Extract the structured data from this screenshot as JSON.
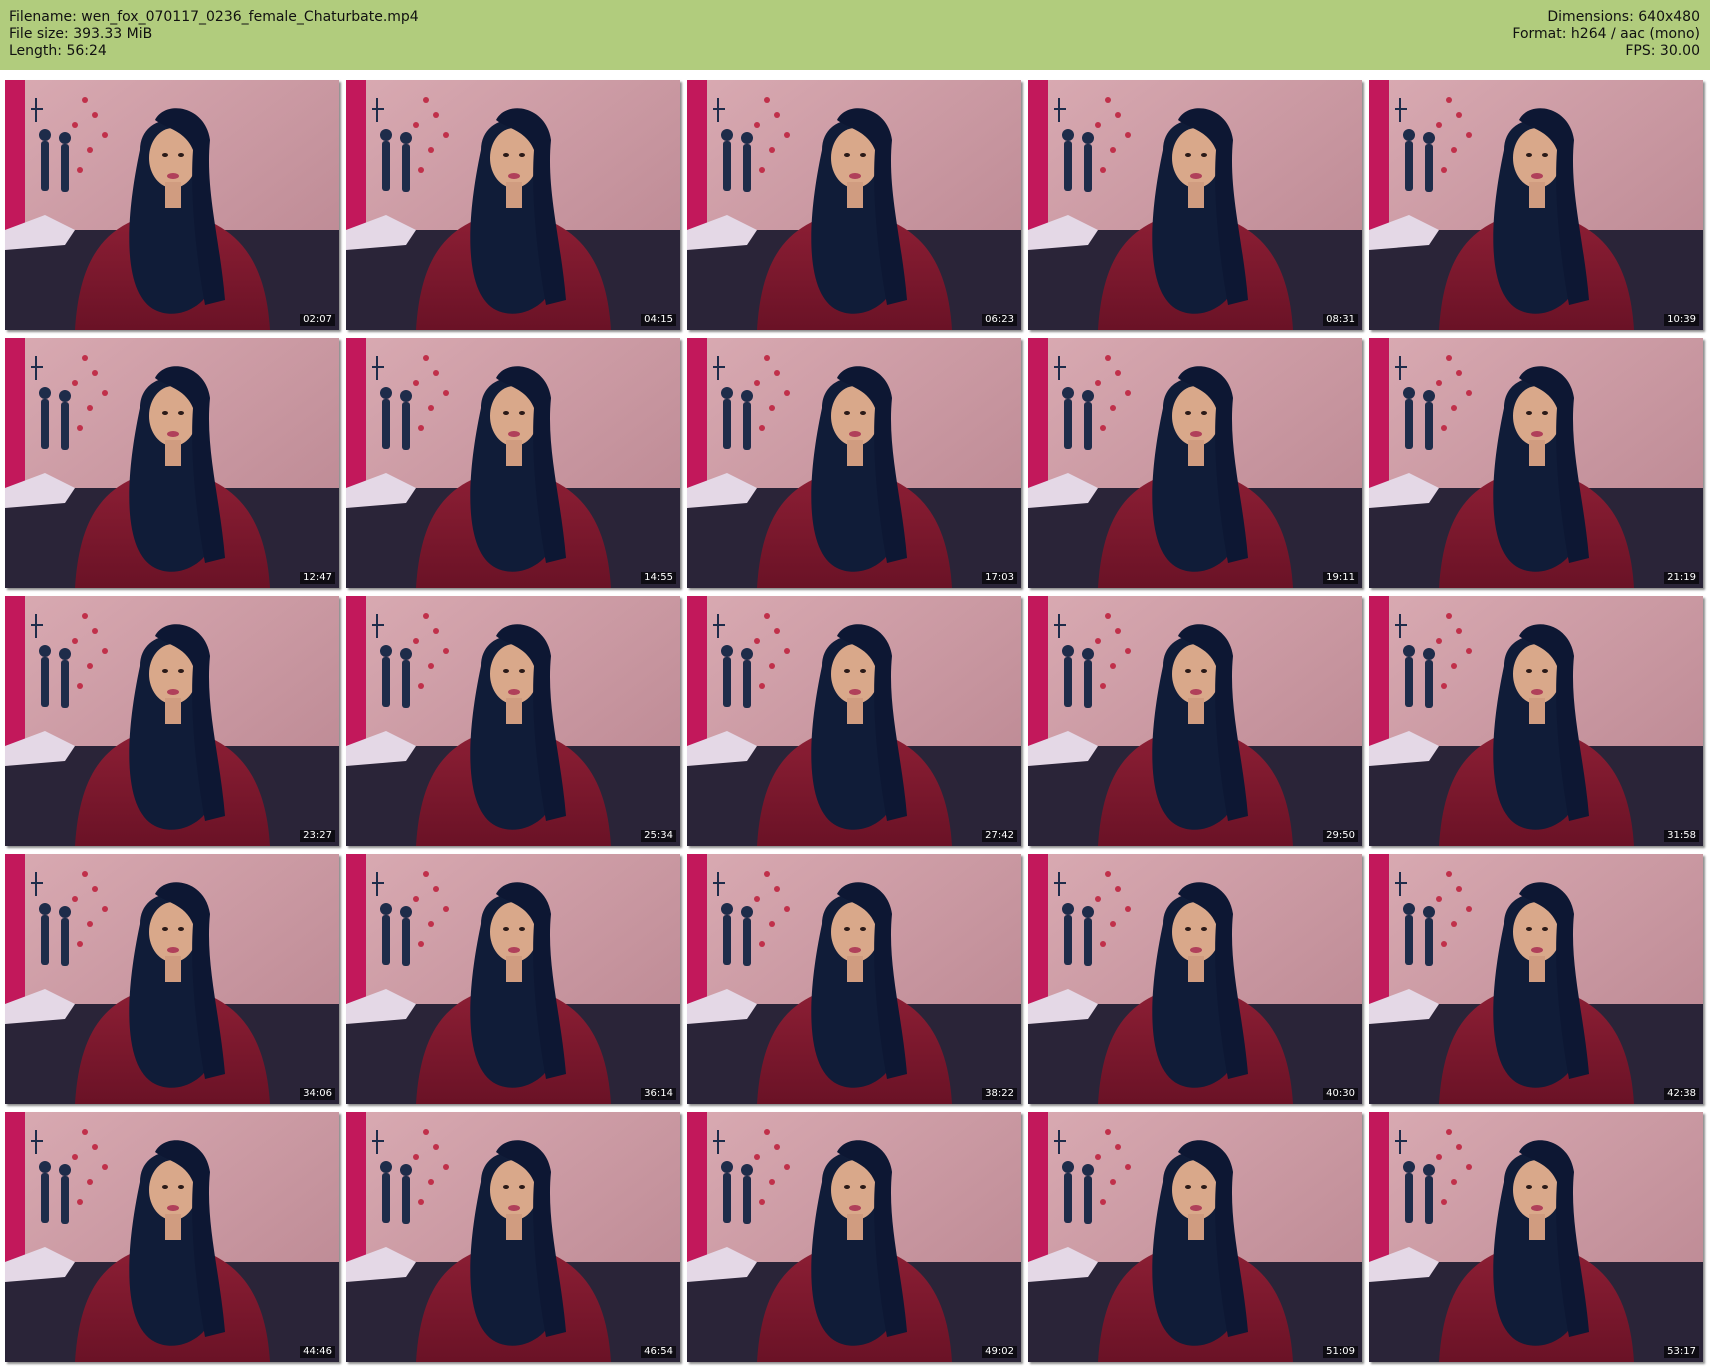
{
  "colors": {
    "header_background": "#b1cc7d",
    "page_background": "#ffffff"
  },
  "header": {
    "filename": "Filename: wen_fox_070117_0236_female_Chaturbate.mp4",
    "file_size": "File size: 393.33 MiB",
    "length": "Length: 56:24",
    "dimensions": "Dimensions: 640x480",
    "format": "Format: h264 / aac (mono)",
    "fps": "FPS: 30.00"
  },
  "thumbnails": [
    {
      "timestamp": "02:07"
    },
    {
      "timestamp": "04:15"
    },
    {
      "timestamp": "06:23"
    },
    {
      "timestamp": "08:31"
    },
    {
      "timestamp": "10:39"
    },
    {
      "timestamp": "12:47"
    },
    {
      "timestamp": "14:55"
    },
    {
      "timestamp": "17:03"
    },
    {
      "timestamp": "19:11"
    },
    {
      "timestamp": "21:19"
    },
    {
      "timestamp": "23:27"
    },
    {
      "timestamp": "25:34"
    },
    {
      "timestamp": "27:42"
    },
    {
      "timestamp": "29:50"
    },
    {
      "timestamp": "31:58"
    },
    {
      "timestamp": "34:06"
    },
    {
      "timestamp": "36:14"
    },
    {
      "timestamp": "38:22"
    },
    {
      "timestamp": "40:30"
    },
    {
      "timestamp": "42:38"
    },
    {
      "timestamp": "44:46"
    },
    {
      "timestamp": "46:54"
    },
    {
      "timestamp": "49:02"
    },
    {
      "timestamp": "51:09"
    },
    {
      "timestamp": "53:17"
    }
  ]
}
